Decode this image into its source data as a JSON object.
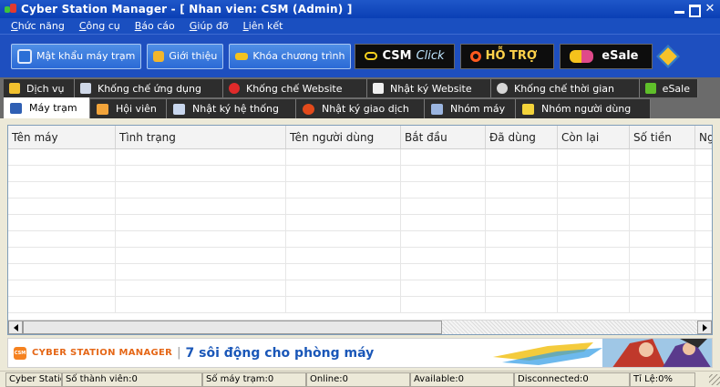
{
  "window": {
    "title": "Cyber Station Manager - [ Nhan vien: CSM (Admin) ]"
  },
  "menu": [
    "Chức năng",
    "Công cụ",
    "Báo cáo",
    "Giúp đỡ",
    "Liên kết"
  ],
  "toolbar": {
    "buttons": [
      {
        "label": "Mật khẩu máy trạm",
        "icon": "key-monitor-icon",
        "color": "#2a6fd6"
      },
      {
        "label": "Giới thiệu",
        "icon": "intro-icon",
        "color": "#f2b62c"
      },
      {
        "label": "Khóa chương trình",
        "icon": "lock-key-icon",
        "color": "#f3c320"
      }
    ],
    "csm_label": "CSM",
    "click_label": "Click",
    "support_label": "HỖ TRỢ",
    "esale_label": "eSale"
  },
  "tabs_row1": [
    {
      "label": "Dịch vụ",
      "icon": "service-icon",
      "color": "#f2c12e"
    },
    {
      "label": "Khống chế ứng dụng",
      "icon": "app-control-icon",
      "color": "#cfd8e8"
    },
    {
      "label": "Khống chế Website",
      "icon": "website-block-icon",
      "color": "#e02a2a"
    },
    {
      "label": "Nhật ký Website",
      "icon": "website-log-icon",
      "color": "#f0f0f0"
    },
    {
      "label": "Khống chế thời gian",
      "icon": "time-control-icon",
      "color": "#d7d7d7"
    },
    {
      "label": "eSale",
      "icon": "esale-icon",
      "color": "#5fbf2a"
    }
  ],
  "tabs_row2": [
    {
      "label": "Máy trạm",
      "icon": "workstation-icon",
      "color": "#2f5fb3",
      "active": true
    },
    {
      "label": "Hội viên",
      "icon": "member-icon",
      "color": "#f2a43a",
      "active": false
    },
    {
      "label": "Nhật ký hệ thống",
      "icon": "system-log-icon",
      "color": "#c9d7ee",
      "active": false
    },
    {
      "label": "Nhật ký giao dịch",
      "icon": "transaction-log-icon",
      "color": "#e34a1b",
      "active": false
    },
    {
      "label": "Nhóm máy",
      "icon": "machine-group-icon",
      "color": "#9bb5e0",
      "active": false
    },
    {
      "label": "Nhóm người dùng",
      "icon": "user-group-icon",
      "color": "#f3d33a",
      "active": false
    }
  ],
  "grid": {
    "columns": [
      "Tên máy",
      "Tình trạng",
      "Tên người dùng",
      "Bắt đầu",
      "Đã dùng",
      "Còn lại",
      "Số tiền",
      "Ng"
    ],
    "empty_rows": 10
  },
  "banner": {
    "logo_text": "CSM",
    "brand": "CYBER STATION MANAGER",
    "separator": "|",
    "slogan": "7 sôi động cho phòng máy"
  },
  "status": [
    "Cyber Station Manager",
    "Số thành viên:0",
    "Số máy trạm:0",
    "Online:0",
    "Available:0",
    "Disconnected:0",
    "Tỉ Lệ:0%"
  ]
}
